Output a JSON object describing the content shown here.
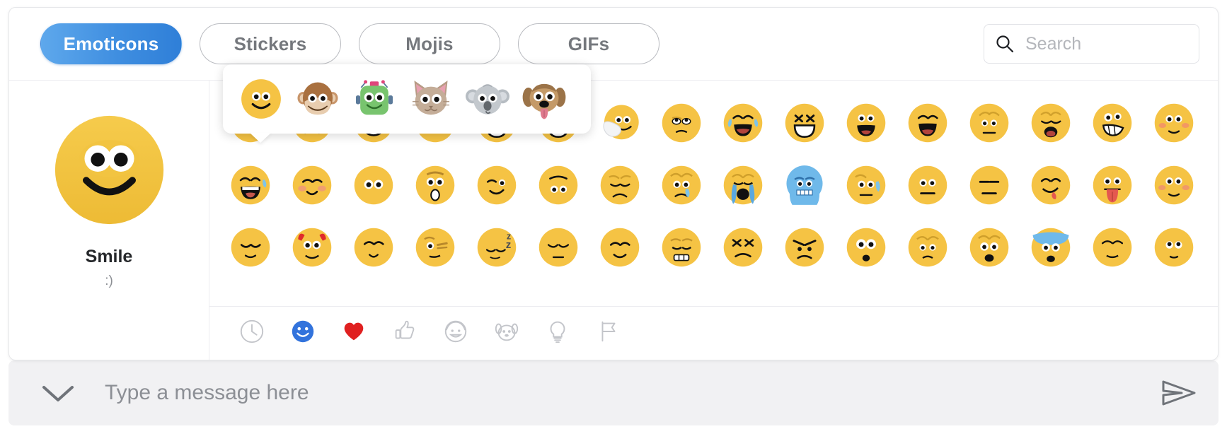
{
  "tabs": [
    {
      "label": "Emoticons",
      "active": true
    },
    {
      "label": "Stickers",
      "active": false
    },
    {
      "label": "Mojis",
      "active": false
    },
    {
      "label": "GIFs",
      "active": false
    }
  ],
  "search": {
    "placeholder": "Search",
    "value": "",
    "icon": "search-icon"
  },
  "preview": {
    "emoji": "smile",
    "name": "Smile",
    "shortcode": ":)"
  },
  "variant_popover": {
    "visible": true,
    "items": [
      {
        "name": "smile-yellow",
        "icon": "smiley-face-icon"
      },
      {
        "name": "smile-monkey",
        "icon": "monkey-face-icon"
      },
      {
        "name": "smile-robot",
        "icon": "robot-face-icon"
      },
      {
        "name": "smile-cat",
        "icon": "cat-face-icon"
      },
      {
        "name": "smile-koala",
        "icon": "koala-face-icon"
      },
      {
        "name": "smile-dog",
        "icon": "dog-face-icon"
      }
    ]
  },
  "grid": {
    "rows": [
      [
        {
          "name": "smile",
          "variants": true
        },
        {
          "name": "sad",
          "variants": true
        },
        {
          "name": "laugh",
          "variants": true
        },
        {
          "name": "cool",
          "variants": true
        },
        {
          "name": "heart-eyes",
          "variants": true
        },
        {
          "name": "star-eyes",
          "variants": true
        },
        {
          "name": "giggle",
          "variants": false
        },
        {
          "name": "rolling-eyes",
          "variants": false
        },
        {
          "name": "tears-of-joy",
          "variants": false
        },
        {
          "name": "squint-laugh",
          "variants": false
        },
        {
          "name": "happy",
          "variants": false
        },
        {
          "name": "big-grin",
          "variants": false
        },
        {
          "name": "worried",
          "variants": false
        },
        {
          "name": "wail",
          "variants": false
        },
        {
          "name": "smirk-teeth",
          "variants": false
        },
        {
          "name": "blush-shy",
          "variants": false
        }
      ],
      [
        {
          "name": "sweat-laugh",
          "variants": false
        },
        {
          "name": "blushing",
          "variants": false
        },
        {
          "name": "stare",
          "variants": false
        },
        {
          "name": "surprised",
          "variants": false
        },
        {
          "name": "wink",
          "variants": false
        },
        {
          "name": "speechless",
          "variants": false
        },
        {
          "name": "sleepy-sad",
          "variants": false
        },
        {
          "name": "sad-tear",
          "variants": false
        },
        {
          "name": "crying",
          "variants": false
        },
        {
          "name": "cold",
          "variants": false
        },
        {
          "name": "sweat-nervous",
          "variants": false
        },
        {
          "name": "flat-face",
          "variants": false
        },
        {
          "name": "unamused",
          "variants": false
        },
        {
          "name": "tongue-out-happy",
          "variants": false
        },
        {
          "name": "tongue-out",
          "variants": false
        },
        {
          "name": "embarrassed",
          "variants": false
        }
      ],
      [
        {
          "name": "relieved",
          "variants": false
        },
        {
          "name": "devil",
          "variants": false
        },
        {
          "name": "content",
          "variants": false
        },
        {
          "name": "raised-eyebrow",
          "variants": false
        },
        {
          "name": "sleeping",
          "variants": false
        },
        {
          "name": "bored",
          "variants": false
        },
        {
          "name": "smiling-closed-eyes",
          "variants": false
        },
        {
          "name": "grimace",
          "variants": false
        },
        {
          "name": "frustrated",
          "variants": false
        },
        {
          "name": "angry",
          "variants": false
        },
        {
          "name": "shocked",
          "variants": false
        },
        {
          "name": "anxious",
          "variants": false
        },
        {
          "name": "scared",
          "variants": false
        },
        {
          "name": "shocked-blue",
          "variants": false
        },
        {
          "name": "sheepish",
          "variants": false
        },
        {
          "name": "innocent",
          "variants": false
        }
      ]
    ]
  },
  "categories": [
    {
      "name": "recent",
      "icon": "clock-icon",
      "active": false
    },
    {
      "name": "smileys",
      "icon": "smiley-icon",
      "active": true
    },
    {
      "name": "hearts",
      "icon": "heart-icon",
      "active": false
    },
    {
      "name": "gestures",
      "icon": "thumbs-up-icon",
      "active": false
    },
    {
      "name": "people",
      "icon": "person-face-icon",
      "active": false
    },
    {
      "name": "animals",
      "icon": "dog-icon",
      "active": false
    },
    {
      "name": "objects",
      "icon": "lightbulb-icon",
      "active": false
    },
    {
      "name": "flags",
      "icon": "flag-icon",
      "active": false
    }
  ],
  "composer": {
    "placeholder": "Type a message here",
    "value": "",
    "collapse_icon": "chevron-down-icon",
    "send_icon": "send-icon"
  },
  "colors": {
    "accent": "#3f8ee0",
    "accent_light": "#5ea8ec",
    "heart_red": "#e02020",
    "emoji_yellow": "#f5c344",
    "text_dark": "#26282b",
    "text_muted": "#8d9095",
    "border": "#e6e7ea",
    "composer_bg": "#f1f1f3"
  }
}
